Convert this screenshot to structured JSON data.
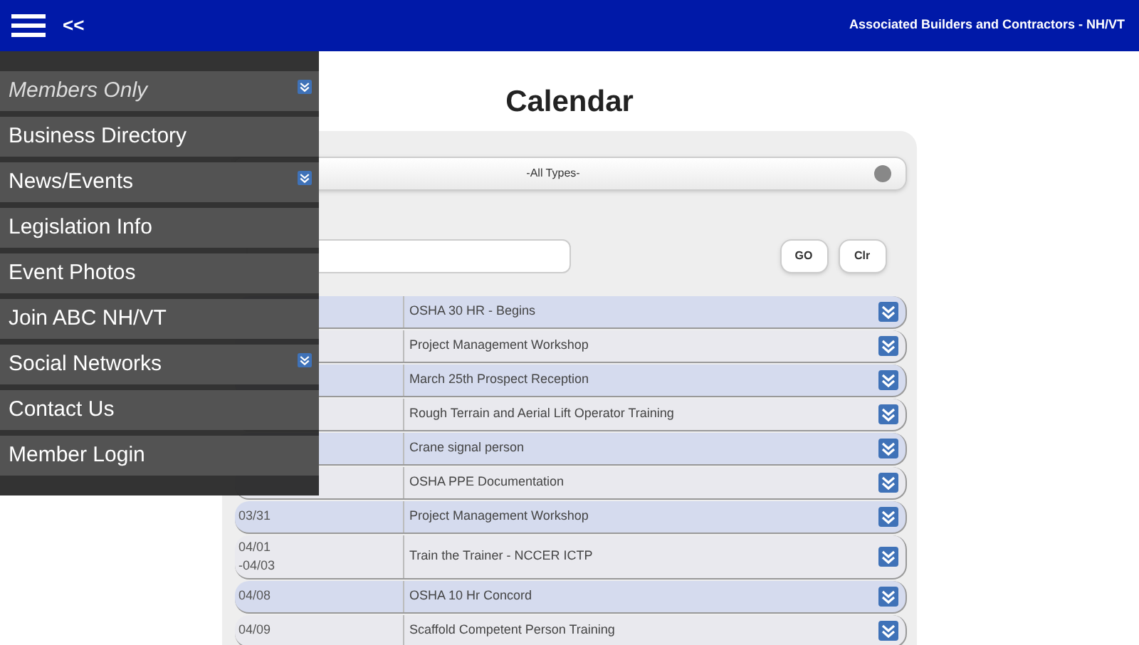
{
  "header": {
    "back": "<<",
    "title": "Associated Builders and Contractors - NH/VT"
  },
  "menu": [
    {
      "label": "Members Only",
      "kind": "section",
      "has_submenu": true
    },
    {
      "label": "Business Directory",
      "kind": "link",
      "has_submenu": false
    },
    {
      "label": "News/Events",
      "kind": "link",
      "has_submenu": true
    },
    {
      "label": "Legislation Info",
      "kind": "link",
      "has_submenu": false
    },
    {
      "label": "Event Photos",
      "kind": "link",
      "has_submenu": false
    },
    {
      "label": "Join ABC NH/VT",
      "kind": "link",
      "has_submenu": false
    },
    {
      "label": "Social Networks",
      "kind": "link",
      "has_submenu": true
    },
    {
      "label": "Contact Us",
      "kind": "link",
      "has_submenu": false
    },
    {
      "label": "Member Login",
      "kind": "link",
      "has_submenu": false
    }
  ],
  "page_title": "Calendar",
  "filters": {
    "event_type_value": "-All Types-",
    "go": "GO",
    "clear": "Clr"
  },
  "events": [
    {
      "title": "OSHA 30 HR - Begins"
    },
    {
      "title": "Project Management Workshop"
    },
    {
      "title": "March 25th Prospect Reception"
    },
    {
      "title": "Rough Terrain and Aerial Lift Operator Training"
    },
    {
      "title": "Crane signal person"
    },
    {
      "title": "OSHA PPE Documentation"
    },
    {
      "date": "03/31",
      "title": "Project Management Workshop"
    },
    {
      "date": "04/01 -04/03",
      "title": "Train the Trainer - NCCER ICTP"
    },
    {
      "date": "04/08",
      "title": "OSHA 10 Hr Concord"
    },
    {
      "date": "04/09",
      "title": "Scaffold Competent Person Training"
    }
  ]
}
